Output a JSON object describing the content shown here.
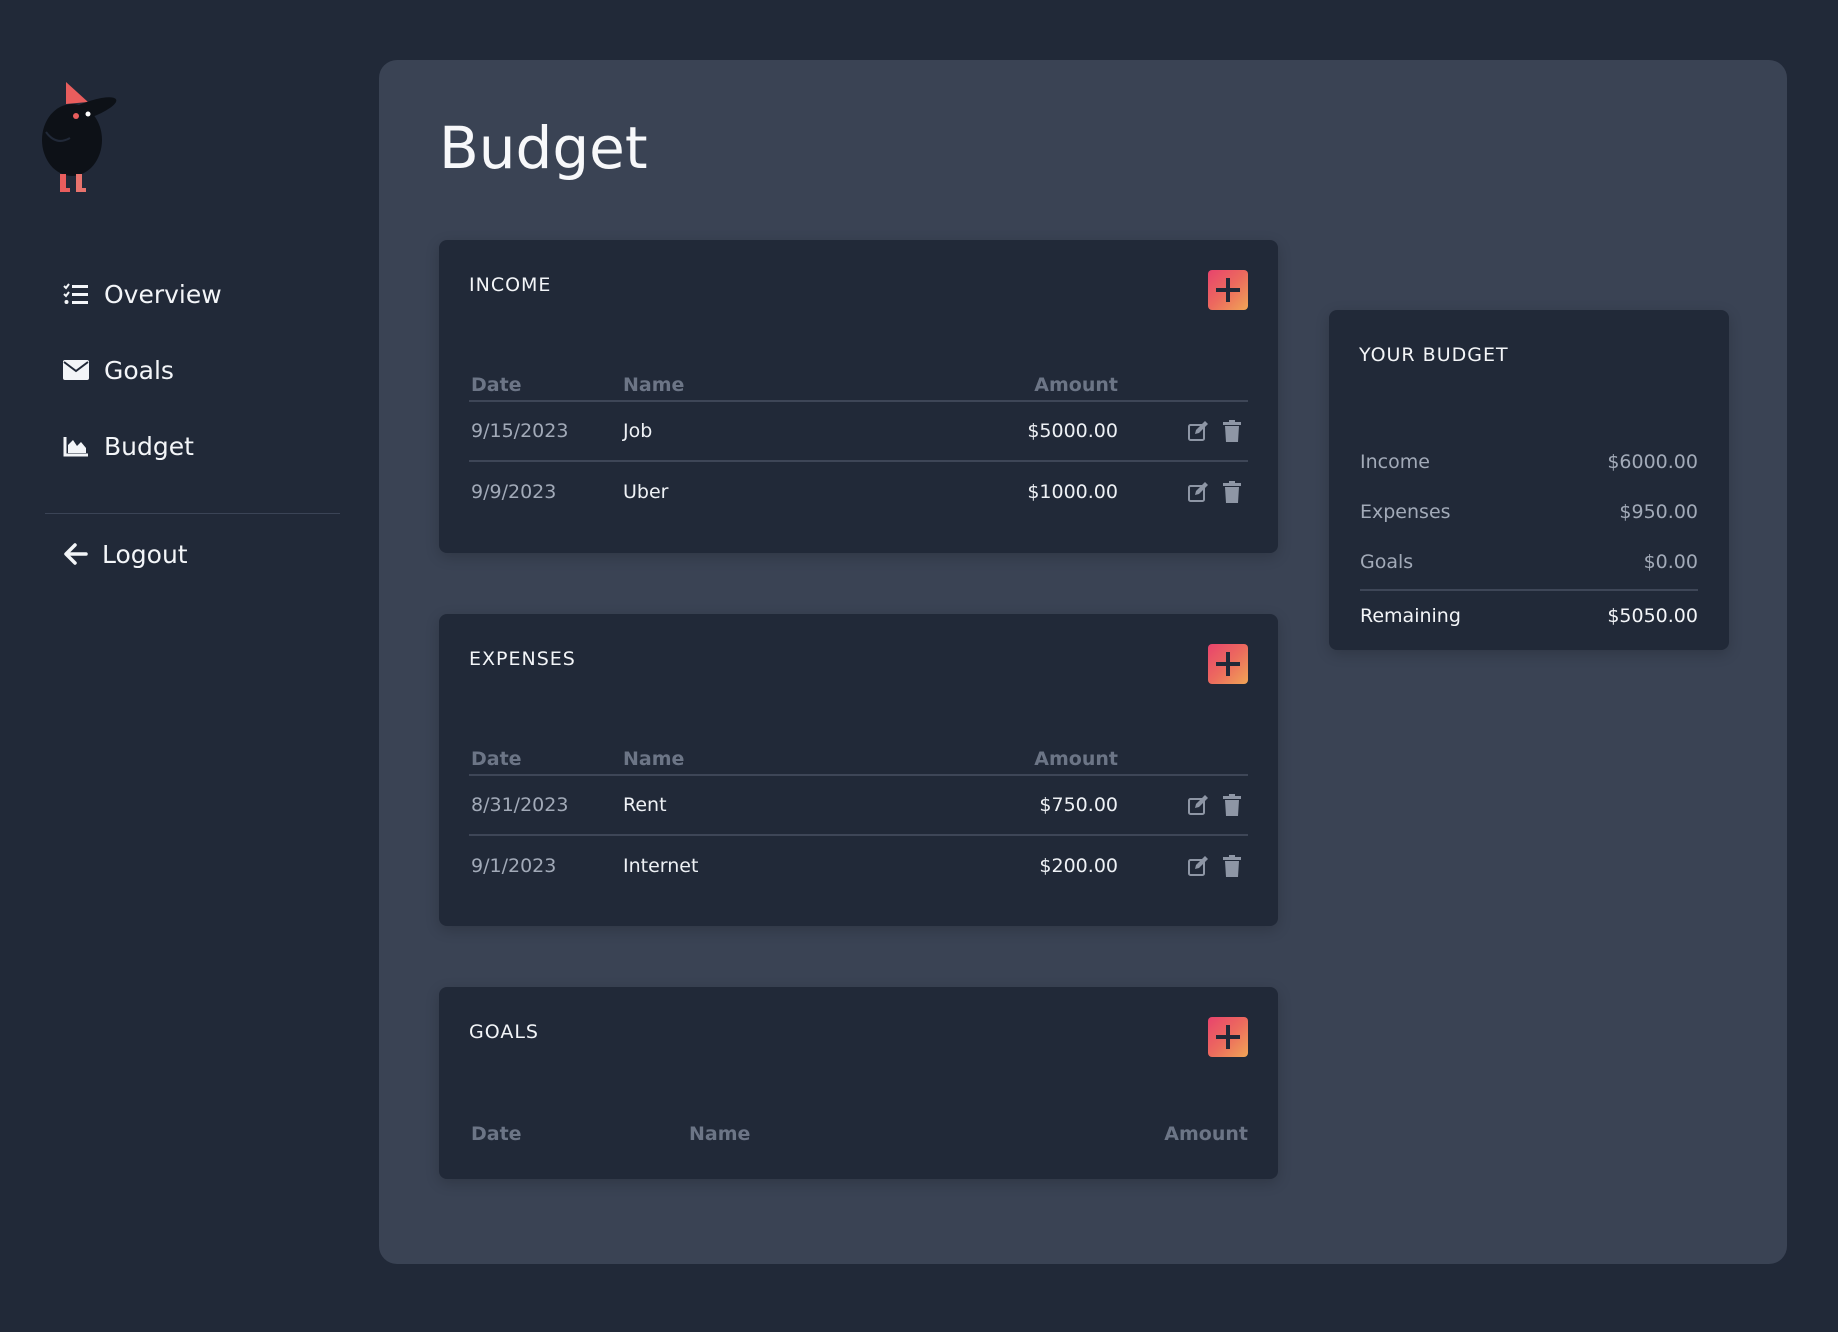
{
  "sidebar": {
    "items": [
      {
        "label": "Overview",
        "icon": "list-check-icon"
      },
      {
        "label": "Goals",
        "icon": "envelope-icon"
      },
      {
        "label": "Budget",
        "icon": "area-chart-icon"
      }
    ],
    "logout_label": "Logout"
  },
  "main": {
    "title": "Budget",
    "income": {
      "title": "INCOME",
      "headers": {
        "date": "Date",
        "name": "Name",
        "amount": "Amount"
      },
      "rows": [
        {
          "date": "9/15/2023",
          "name": "Job",
          "amount": "$5000.00"
        },
        {
          "date": "9/9/2023",
          "name": "Uber",
          "amount": "$1000.00"
        }
      ]
    },
    "expenses": {
      "title": "EXPENSES",
      "headers": {
        "date": "Date",
        "name": "Name",
        "amount": "Amount"
      },
      "rows": [
        {
          "date": "8/31/2023",
          "name": "Rent",
          "amount": "$750.00"
        },
        {
          "date": "9/1/2023",
          "name": "Internet",
          "amount": "$200.00"
        }
      ]
    },
    "goals": {
      "title": "GOALS",
      "headers": {
        "date": "Date",
        "name": "Name",
        "amount": "Amount"
      }
    },
    "summary": {
      "title": "YOUR BUDGET",
      "rows": [
        {
          "label": "Income",
          "value": "$6000.00"
        },
        {
          "label": "Expenses",
          "value": "$950.00"
        },
        {
          "label": "Goals",
          "value": "$0.00"
        }
      ],
      "total": {
        "label": "Remaining",
        "value": "$5050.00"
      }
    }
  },
  "colors": {
    "background": "#212938",
    "panel": "#3a4354",
    "card": "#212938",
    "accent_start": "#e8436d",
    "accent_end": "#f0a556"
  }
}
